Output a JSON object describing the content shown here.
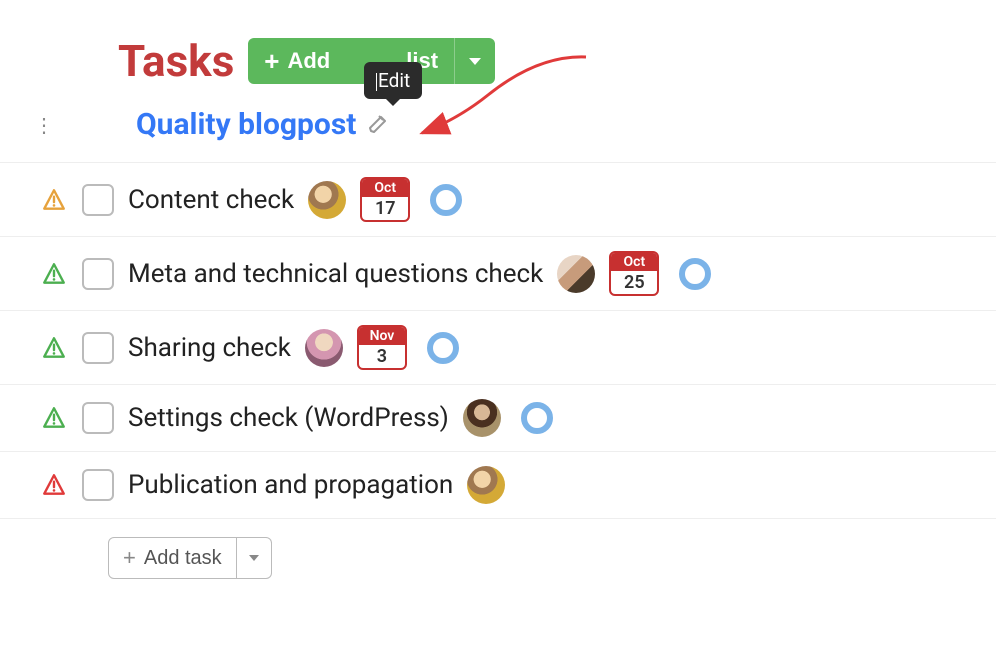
{
  "header": {
    "title": "Tasks",
    "add_button_label_prefix": "Add",
    "add_button_label_suffix": "list"
  },
  "tooltip": {
    "text": "Edit"
  },
  "list": {
    "title": "Quality blogpost"
  },
  "tasks": [
    {
      "priority_color": "#e6a23c",
      "title": "Content check",
      "avatar": "avatar1",
      "date": {
        "month": "Oct",
        "day": "17"
      },
      "show_status": true
    },
    {
      "priority_color": "#4caf50",
      "title": "Meta and technical questions check",
      "avatar": "avatar2",
      "date": {
        "month": "Oct",
        "day": "25"
      },
      "show_status": true
    },
    {
      "priority_color": "#4caf50",
      "title": "Sharing check",
      "avatar": "avatar3",
      "date": {
        "month": "Nov",
        "day": "3"
      },
      "show_status": true
    },
    {
      "priority_color": "#4caf50",
      "title": "Settings check (WordPress)",
      "avatar": "avatar4",
      "date": null,
      "show_status": true
    },
    {
      "priority_color": "#e03a3a",
      "title": "Publication and propagation",
      "avatar": "avatar1",
      "date": null,
      "show_status": false
    }
  ],
  "add_task": {
    "label": "Add task"
  },
  "colors": {
    "title": "#c23b3b",
    "link": "#3478f6",
    "button_green": "#5cb85c",
    "date_red": "#c73030",
    "status_blue": "#7bb3e8"
  }
}
